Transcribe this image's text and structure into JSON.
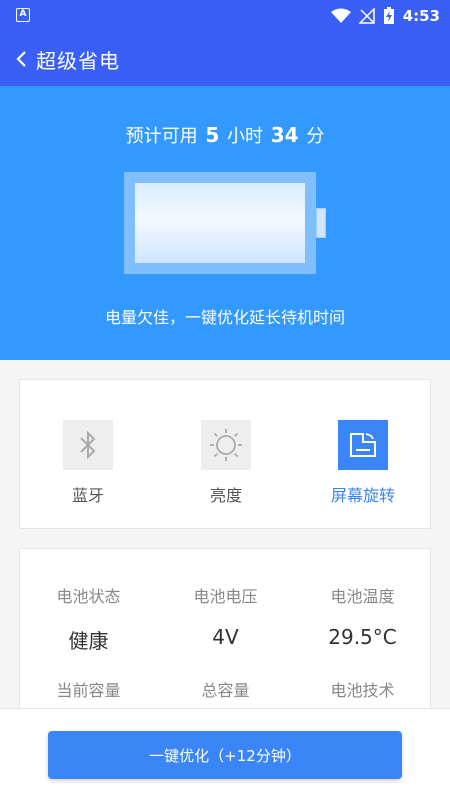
{
  "status_bar": {
    "time": "4:53"
  },
  "app_bar": {
    "title": "超级省电"
  },
  "hero": {
    "estimate_prefix": "预计可用",
    "hours": "5",
    "hours_unit": "小时",
    "minutes": "34",
    "minutes_unit": "分",
    "hint": "电量欠佳，一键优化延长待机时间"
  },
  "toggles": [
    {
      "label": "蓝牙",
      "icon": "bluetooth-icon",
      "active": false
    },
    {
      "label": "亮度",
      "icon": "brightness-icon",
      "active": false
    },
    {
      "label": "屏幕旋转",
      "icon": "screen-rotation-icon",
      "active": true
    }
  ],
  "battery_info": [
    {
      "label": "电池状态",
      "value": "健康"
    },
    {
      "label": "电池电压",
      "value": "4V"
    },
    {
      "label": "电池温度",
      "value": "29.5°C"
    },
    {
      "label": "当前容量",
      "value": ""
    },
    {
      "label": "总容量",
      "value": ""
    },
    {
      "label": "电池技术",
      "value": ""
    }
  ],
  "bottom": {
    "button_label": "一键优化（+12分钟）"
  },
  "colors": {
    "primary": "#3a5ff7",
    "hero": "#3399ff",
    "accent": "#3a86f7"
  }
}
